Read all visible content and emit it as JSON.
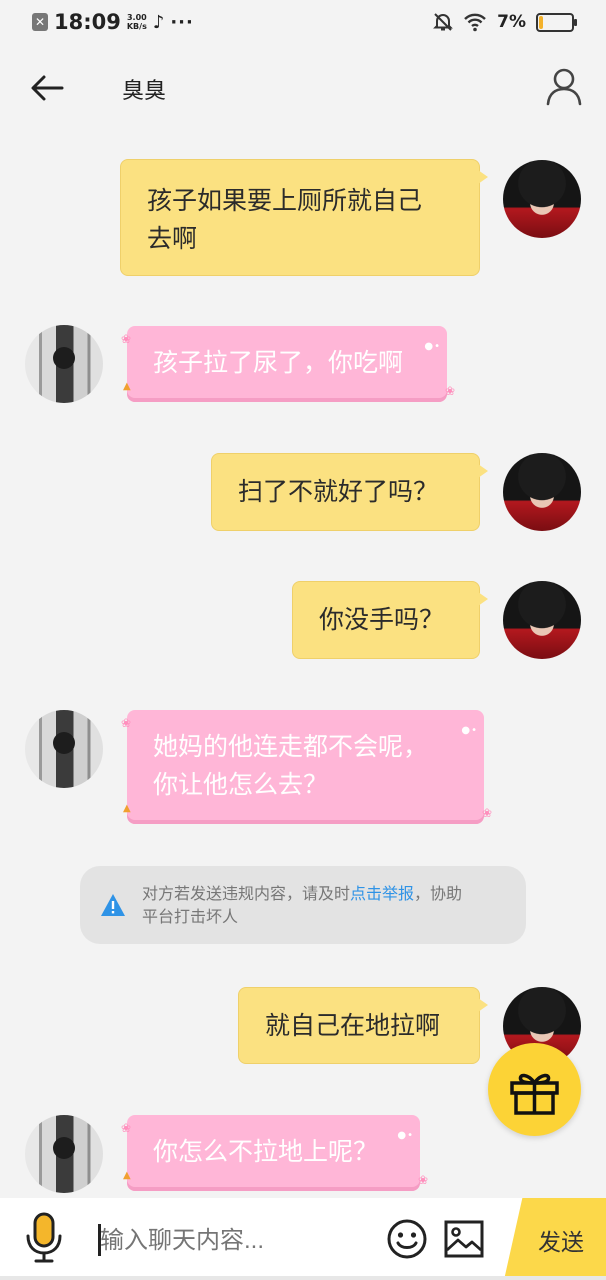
{
  "status_bar": {
    "time": "18:09",
    "net_speed_value": "3.00",
    "net_speed_unit": "KB/s",
    "battery_percent": "7%",
    "battery_level": 0.07
  },
  "header": {
    "title": "臭臭"
  },
  "messages": [
    {
      "from": "me",
      "text_lines": [
        "孩子如果要上厕所就自己",
        "去啊"
      ]
    },
    {
      "from": "them",
      "text_lines": [
        "孩子拉了尿了，你吃啊"
      ]
    },
    {
      "from": "me",
      "text_lines": [
        "扫了不就好了吗？"
      ]
    },
    {
      "from": "me",
      "text_lines": [
        "你没手吗？"
      ]
    },
    {
      "from": "them",
      "text_lines": [
        "她妈的他连走都不会呢，",
        "你让他怎么去？"
      ]
    },
    {
      "from": "me",
      "text_lines": [
        "就自己在地拉啊"
      ]
    },
    {
      "from": "them",
      "text_lines": [
        "你怎么不拉地上呢？"
      ]
    }
  ],
  "notice": {
    "text_before": "对方若发送违规内容，请及时",
    "link": "点击举报",
    "text_after": "，协助",
    "line2": "平台打击坏人"
  },
  "input_bar": {
    "placeholder": "输入聊天内容...",
    "send_label": "发送"
  },
  "colors": {
    "my_bubble": "#fbe181",
    "their_bubble": "#ffb6d7",
    "accent_yellow": "#fcd336",
    "link_blue": "#2f93e6"
  }
}
